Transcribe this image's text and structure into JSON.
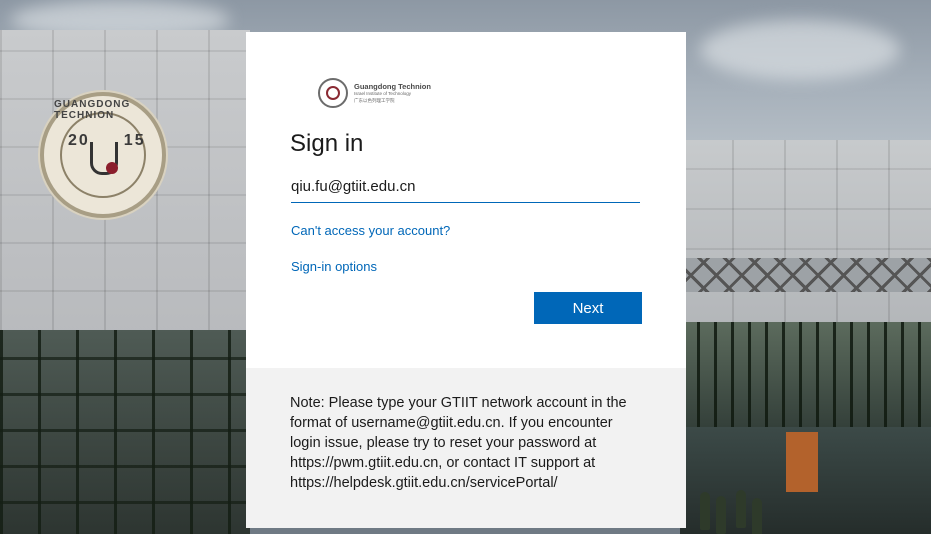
{
  "background": {
    "emblem": {
      "name_arc": "GUANGDONG TECHNION",
      "year_left": "20",
      "year_right": "15"
    }
  },
  "logo": {
    "title": "Guangdong Technion",
    "subtitle": "Israel Institute of Technology",
    "chinese": "广东以色列理工学院"
  },
  "signin": {
    "title": "Sign in",
    "email_value": "qiu.fu@gtiit.edu.cn",
    "cant_access_link": "Can't access your account?",
    "signin_options_link": "Sign-in options",
    "next_button": "Next"
  },
  "note": {
    "text": "Note: Please type your GTIIT network account in the format of username@gtiit.edu.cn. If you encounter login issue, please try to reset your password at https://pwm.gtiit.edu.cn, or contact IT support at https://helpdesk.gtiit.edu.cn/servicePortal/"
  },
  "colors": {
    "accent": "#0067b8",
    "note_background": "#f2f2f2",
    "card_background": "#ffffff",
    "text": "#1b1b1b"
  }
}
